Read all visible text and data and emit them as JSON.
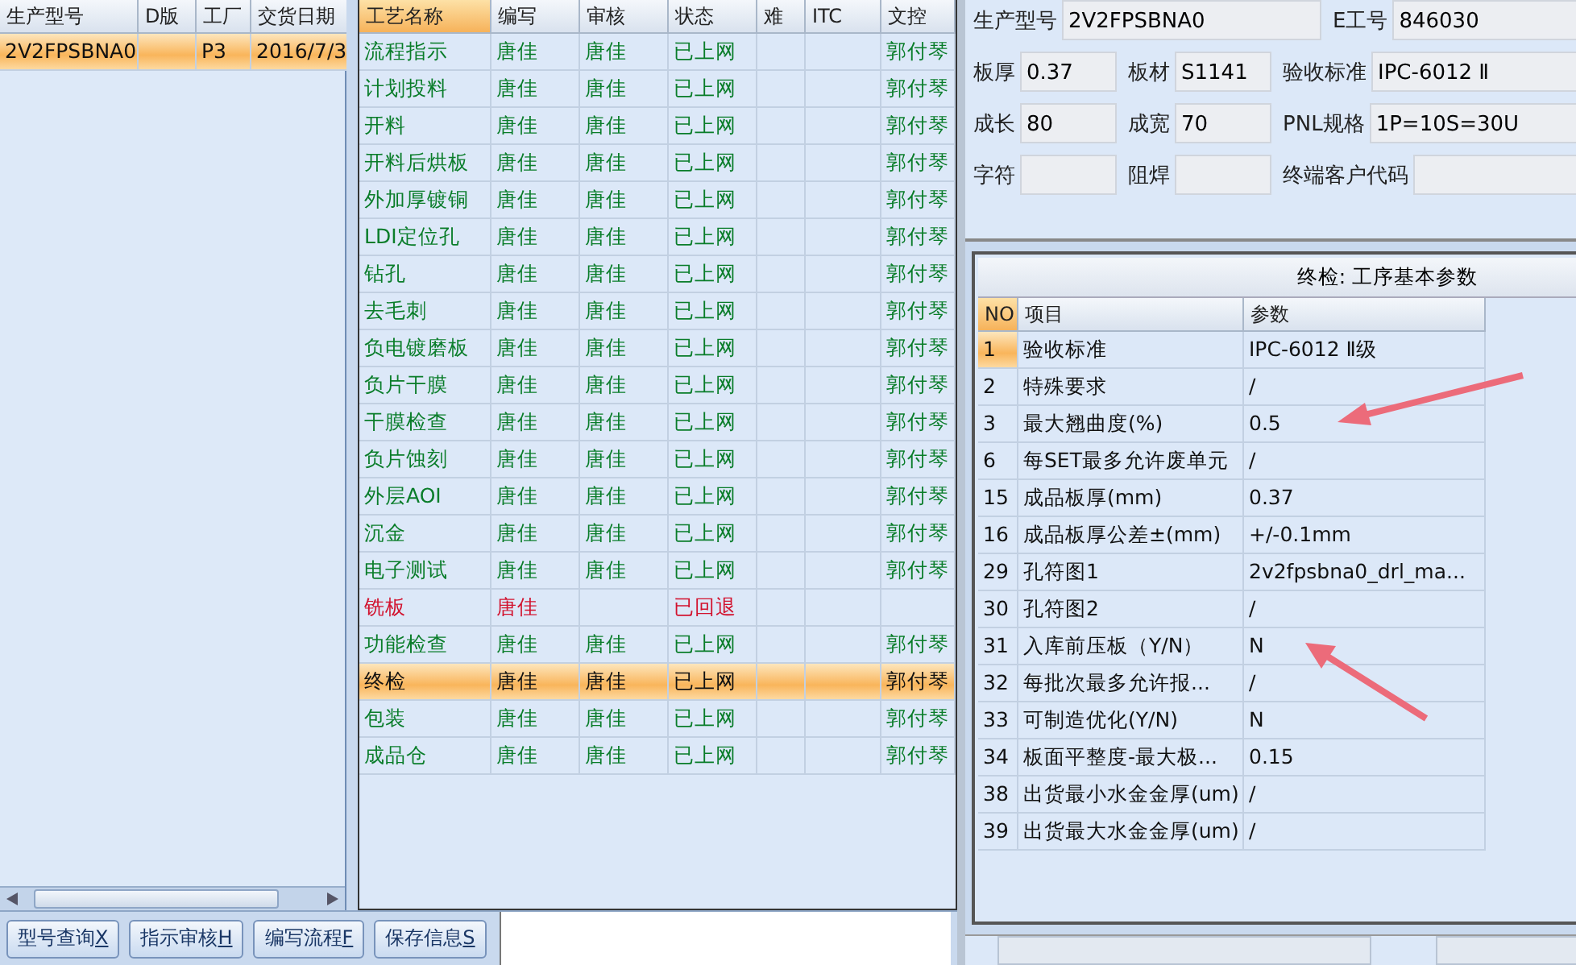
{
  "models_table": {
    "columns": [
      "生产型号",
      "D版",
      "工厂",
      "交货日期"
    ],
    "rows": [
      {
        "cells": [
          "2V2FPSBNA0",
          "",
          "P3",
          "2016/7/3"
        ],
        "selected": true
      }
    ]
  },
  "process_table": {
    "columns": [
      "工艺名称",
      "编写",
      "审核",
      "状态",
      "难",
      "ITC",
      "文控"
    ],
    "rows": [
      {
        "cells": [
          "流程指示",
          "唐佳",
          "唐佳",
          "已上网",
          "",
          "",
          "郭付琴"
        ],
        "kind": "online",
        "selected": false
      },
      {
        "cells": [
          "计划投料",
          "唐佳",
          "唐佳",
          "已上网",
          "",
          "",
          "郭付琴"
        ],
        "kind": "online",
        "selected": false
      },
      {
        "cells": [
          "开料",
          "唐佳",
          "唐佳",
          "已上网",
          "",
          "",
          "郭付琴"
        ],
        "kind": "online",
        "selected": false
      },
      {
        "cells": [
          "开料后烘板",
          "唐佳",
          "唐佳",
          "已上网",
          "",
          "",
          "郭付琴"
        ],
        "kind": "online",
        "selected": false
      },
      {
        "cells": [
          "外加厚镀铜",
          "唐佳",
          "唐佳",
          "已上网",
          "",
          "",
          "郭付琴"
        ],
        "kind": "online",
        "selected": false
      },
      {
        "cells": [
          "LDI定位孔",
          "唐佳",
          "唐佳",
          "已上网",
          "",
          "",
          "郭付琴"
        ],
        "kind": "online",
        "selected": false
      },
      {
        "cells": [
          "钻孔",
          "唐佳",
          "唐佳",
          "已上网",
          "",
          "",
          "郭付琴"
        ],
        "kind": "online",
        "selected": false
      },
      {
        "cells": [
          "去毛刺",
          "唐佳",
          "唐佳",
          "已上网",
          "",
          "",
          "郭付琴"
        ],
        "kind": "online",
        "selected": false
      },
      {
        "cells": [
          "负电镀磨板",
          "唐佳",
          "唐佳",
          "已上网",
          "",
          "",
          "郭付琴"
        ],
        "kind": "online",
        "selected": false
      },
      {
        "cells": [
          "负片干膜",
          "唐佳",
          "唐佳",
          "已上网",
          "",
          "",
          "郭付琴"
        ],
        "kind": "online",
        "selected": false
      },
      {
        "cells": [
          "干膜检查",
          "唐佳",
          "唐佳",
          "已上网",
          "",
          "",
          "郭付琴"
        ],
        "kind": "online",
        "selected": false
      },
      {
        "cells": [
          "负片蚀刻",
          "唐佳",
          "唐佳",
          "已上网",
          "",
          "",
          "郭付琴"
        ],
        "kind": "online",
        "selected": false
      },
      {
        "cells": [
          "外层AOI",
          "唐佳",
          "唐佳",
          "已上网",
          "",
          "",
          "郭付琴"
        ],
        "kind": "online",
        "selected": false
      },
      {
        "cells": [
          "沉金",
          "唐佳",
          "唐佳",
          "已上网",
          "",
          "",
          "郭付琴"
        ],
        "kind": "online",
        "selected": false
      },
      {
        "cells": [
          "电子测试",
          "唐佳",
          "唐佳",
          "已上网",
          "",
          "",
          "郭付琴"
        ],
        "kind": "online",
        "selected": false
      },
      {
        "cells": [
          "铣板",
          "唐佳",
          "",
          "已回退",
          "",
          "",
          ""
        ],
        "kind": "returned",
        "selected": false
      },
      {
        "cells": [
          "功能检查",
          "唐佳",
          "唐佳",
          "已上网",
          "",
          "",
          "郭付琴"
        ],
        "kind": "online",
        "selected": false
      },
      {
        "cells": [
          "终检",
          "唐佳",
          "唐佳",
          "已上网",
          "",
          "",
          "郭付琴"
        ],
        "kind": "online",
        "selected": true
      },
      {
        "cells": [
          "包装",
          "唐佳",
          "唐佳",
          "已上网",
          "",
          "",
          "郭付琴"
        ],
        "kind": "online",
        "selected": false
      },
      {
        "cells": [
          "成品仓",
          "唐佳",
          "唐佳",
          "已上网",
          "",
          "",
          "郭付琴"
        ],
        "kind": "online",
        "selected": false
      }
    ]
  },
  "buttons": [
    {
      "label": "型号查询",
      "hotkey": "X"
    },
    {
      "label": "指示审核",
      "hotkey": "H"
    },
    {
      "label": "编写流程",
      "hotkey": "F"
    },
    {
      "label": "保存信息",
      "hotkey": "S"
    }
  ],
  "info_form": [
    [
      {
        "label": "生产型号",
        "value": "2V2FPSBNA0"
      },
      {
        "label": "E工号",
        "value": "846030"
      }
    ],
    [
      {
        "label": "板厚",
        "value": "0.37"
      },
      {
        "label": "板材",
        "value": "S1141"
      },
      {
        "label": "验收标准",
        "value": "IPC-6012 Ⅱ"
      }
    ],
    [
      {
        "label": "成长",
        "value": "80"
      },
      {
        "label": "成宽",
        "value": "70"
      },
      {
        "label": "PNL规格",
        "value": "1P=10S=30U"
      }
    ],
    [
      {
        "label": "字符"
      },
      {
        "label": "阻焊"
      },
      {
        "label": "终端客户代码"
      }
    ]
  ],
  "params_panel": {
    "title": "终检: 工序基本参数",
    "columns": [
      "NO",
      "项目",
      "参数"
    ],
    "rows": [
      {
        "no": "1",
        "item": "验收标准",
        "value": "IPC-6012 Ⅱ级",
        "selected": true
      },
      {
        "no": "2",
        "item": "特殊要求",
        "value": "/",
        "selected": false
      },
      {
        "no": "3",
        "item": "最大翘曲度(%)",
        "value": "0.5",
        "selected": false
      },
      {
        "no": "6",
        "item": "每SET最多允许废单元",
        "value": "/",
        "selected": false
      },
      {
        "no": "15",
        "item": "成品板厚(mm)",
        "value": "0.37",
        "selected": false
      },
      {
        "no": "16",
        "item": "成品板厚公差±(mm)",
        "value": "+/-0.1mm",
        "selected": false
      },
      {
        "no": "29",
        "item": "孔符图1",
        "value": "2v2fpsbna0_drl_ma...",
        "selected": false
      },
      {
        "no": "30",
        "item": "孔符图2",
        "value": "/",
        "selected": false
      },
      {
        "no": "31",
        "item": "入库前压板（Y/N）",
        "value": "N",
        "selected": false
      },
      {
        "no": "32",
        "item": "每批次最多允许报...",
        "value": "/",
        "selected": false
      },
      {
        "no": "33",
        "item": "可制造优化(Y/N)",
        "value": "N",
        "selected": false
      },
      {
        "no": "34",
        "item": "板面平整度-最大极...",
        "value": "0.15",
        "selected": false
      },
      {
        "no": "38",
        "item": "出货最小水金金厚(um)",
        "value": "/",
        "selected": false
      },
      {
        "no": "39",
        "item": "出货最大水金金厚(um)",
        "value": "/",
        "selected": false
      }
    ]
  }
}
